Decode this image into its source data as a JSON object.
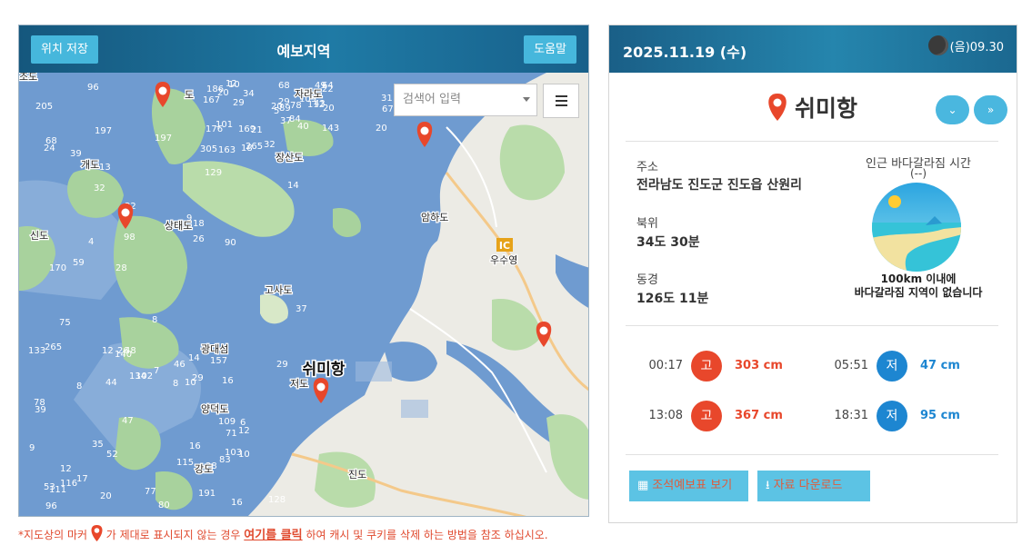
{
  "map": {
    "title": "예보지역",
    "save_label": "위치 저장",
    "help_label": "도움말",
    "search_placeholder": "검색어 입력",
    "labels": {
      "jado": "조도",
      "do_top": "도",
      "jarado": "자라도",
      "gaedo": "개도",
      "jangsando": "장산도",
      "sindo": "신도",
      "sangtaedo": "상태도",
      "amtaedo": "암하도",
      "usuyeong": "우수영",
      "ic": "IC",
      "gosado": "고사도",
      "gwangdaeseom": "광대섬",
      "jeodo": "저도",
      "yangdeokdo": "양덕도",
      "jindo": "진도",
      "gangdo": "강도",
      "selected_port": "쉬미항"
    },
    "depths": [
      "129",
      "75",
      "89",
      "53",
      "18",
      "52",
      "64",
      "102",
      "20",
      "10",
      "12",
      "16",
      "39",
      "37",
      "5",
      "8",
      "4",
      "8",
      "109",
      "12",
      "197",
      "111",
      "169",
      "134",
      "265",
      "6",
      "20",
      "48",
      "24",
      "109",
      "31",
      "47",
      "9",
      "7",
      "34",
      "14",
      "32",
      "128",
      "20",
      "16",
      "10",
      "26",
      "29",
      "115",
      "98",
      "133",
      "112",
      "96",
      "18",
      "29",
      "101",
      "16",
      "205",
      "71",
      "143",
      "17",
      "96",
      "170",
      "40",
      "157",
      "186",
      "44",
      "167",
      "8",
      "43",
      "59",
      "49",
      "140",
      "305",
      "9",
      "37",
      "20",
      "14",
      "12",
      "176",
      "265",
      "197",
      "39",
      "29",
      "77",
      "163",
      "116",
      "20",
      "103",
      "26",
      "29",
      "84",
      "191",
      "90",
      "28",
      "68",
      "12",
      "32",
      "10",
      "78",
      "83",
      "68",
      "80",
      "22",
      "46",
      "13",
      "28",
      "67",
      "78",
      "32",
      "35",
      "21"
    ]
  },
  "footnote": {
    "prefix": "*지도상의 마커",
    "middle": "가 제대로 표시되지 않는 경우",
    "link": "여기를 클릭",
    "suffix": "하여 캐시 및 쿠키를 삭제 하는 방법을 참조 하십시오."
  },
  "info": {
    "date": "2025.11.19 (수)",
    "lunar": "(음)09.30",
    "port": "쉬미항",
    "address_label": "주소",
    "address": "전라남도 진도군 진도읍 산원리",
    "lat_label": "북위",
    "lat": "34도 30분",
    "lon_label": "동경",
    "lon": "126도 11분",
    "sea_part_title": "인근 바다갈라짐 시간",
    "sea_part_value": "(--)",
    "sea_note_line1": "100km 이내에",
    "sea_note_line2": "바다갈라짐 지역이 없습니다",
    "tides": [
      {
        "time": "00:17",
        "type": "고",
        "value": "303 cm"
      },
      {
        "time": "05:51",
        "type": "저",
        "value": "47 cm"
      },
      {
        "time": "13:08",
        "type": "고",
        "value": "367 cm"
      },
      {
        "time": "18:31",
        "type": "저",
        "value": "95 cm"
      }
    ],
    "btn_table": "조석예보표 보기",
    "btn_download": "자료 다운로드"
  },
  "colors": {
    "sea": "#6f9bd0",
    "land": "#ecebe5",
    "green": "#9fd09a",
    "header": "#1f6f98",
    "accent": "#4ab7df",
    "high": "#e8472b",
    "low": "#1d86d1"
  }
}
